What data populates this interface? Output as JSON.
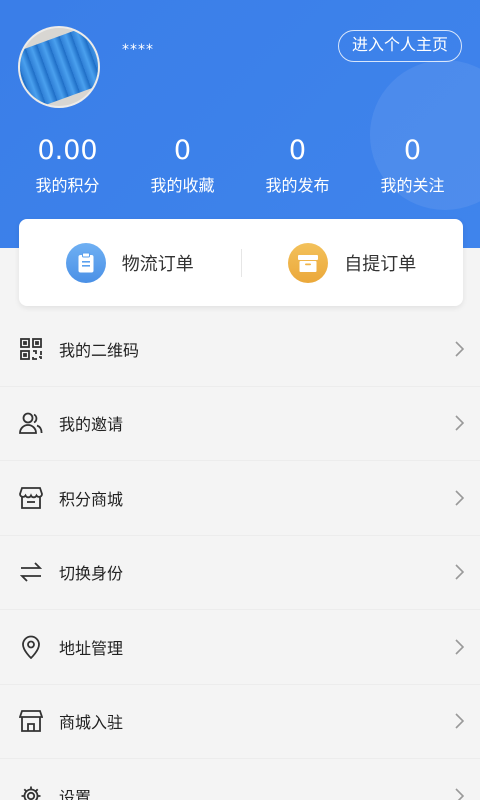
{
  "profile": {
    "username": "****",
    "homepage_button": "进入个人主页"
  },
  "stats": [
    {
      "value": "0.00",
      "label": "我的积分"
    },
    {
      "value": "0",
      "label": "我的收藏"
    },
    {
      "value": "0",
      "label": "我的发布"
    },
    {
      "value": "0",
      "label": "我的关注"
    }
  ],
  "orders": [
    {
      "label": "物流订单",
      "icon": "clipboard-icon",
      "color": "#5aa0ee"
    },
    {
      "label": "自提订单",
      "icon": "box-icon",
      "color": "#f0b54a"
    }
  ],
  "menu": [
    {
      "label": "我的二维码",
      "icon": "qrcode-icon"
    },
    {
      "label": "我的邀请",
      "icon": "users-icon"
    },
    {
      "label": "积分商城",
      "icon": "store-icon"
    },
    {
      "label": "切换身份",
      "icon": "swap-icon"
    },
    {
      "label": "地址管理",
      "icon": "location-pin-icon"
    },
    {
      "label": "商城入驻",
      "icon": "shop-icon"
    },
    {
      "label": "设置",
      "icon": "gear-icon"
    }
  ],
  "colors": {
    "header_blue": "#3f84ec",
    "background": "#f4f4f4"
  }
}
